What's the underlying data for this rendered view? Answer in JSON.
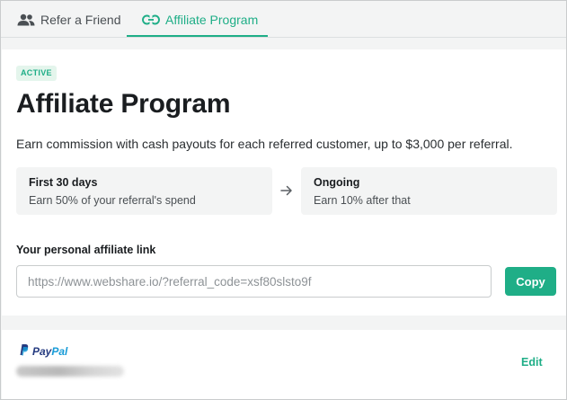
{
  "tabs": [
    {
      "label": "Refer a Friend",
      "active": false,
      "icon": "people-icon"
    },
    {
      "label": "Affiliate Program",
      "active": true,
      "icon": "link-icon"
    }
  ],
  "program": {
    "badge": "ACTIVE",
    "title": "Affiliate Program",
    "description": "Earn commission with cash payouts for each referred customer, up to $3,000 per referral.",
    "phases": [
      {
        "title": "First 30 days",
        "text": "Earn 50% of your referral's spend"
      },
      {
        "title": "Ongoing",
        "text": "Earn 10% after that"
      }
    ],
    "link_label": "Your personal affiliate link",
    "link_value": "https://www.webshare.io/?referral_code=xsf80slsto9f",
    "copy_label": "Copy"
  },
  "payout": {
    "brand_pay": "Pay",
    "brand_pal": "Pal",
    "edit_label": "Edit"
  },
  "colors": {
    "accent": "#1fae87",
    "badge_bg": "#e4f5ec",
    "paypal_dark": "#253b80",
    "paypal_light": "#179bd7"
  }
}
